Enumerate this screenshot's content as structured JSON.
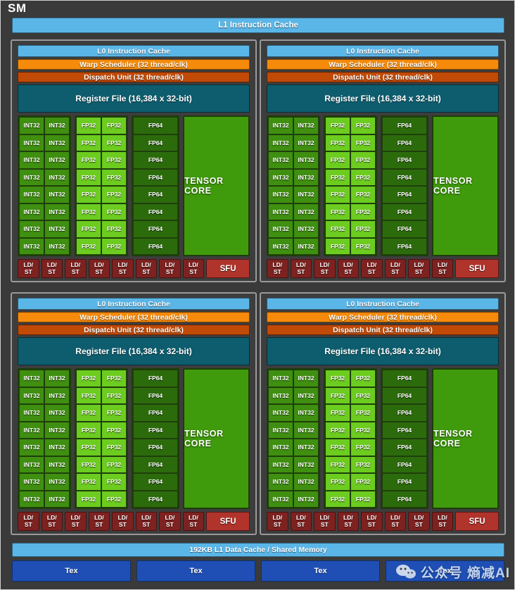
{
  "diagram": {
    "title": "SM",
    "top_cache": "L1 Instruction Cache",
    "bottom_cache": "192KB L1 Data Cache / Shared Memory"
  },
  "processing_block": {
    "l0_cache": "L0 Instruction Cache",
    "warp_scheduler": "Warp Scheduler (32 thread/clk)",
    "dispatch_unit": "Dispatch Unit (32 thread/clk)",
    "register_file": "Register File (16,384 x 32-bit)",
    "int32_label": "INT32",
    "fp32_label": "FP32",
    "fp64_label": "FP64",
    "tensor_core_label": "TENSOR CORE",
    "ldst_label_line1": "LD/",
    "ldst_label_line2": "ST",
    "sfu_label": "SFU",
    "int32_columns": 2,
    "fp32_columns": 2,
    "fp64_columns": 1,
    "rows": 8,
    "ldst_count": 8,
    "sfu_count": 1
  },
  "quadrants": [
    {
      "name": "processing-block-top-left"
    },
    {
      "name": "processing-block-top-right"
    },
    {
      "name": "processing-block-bottom-left"
    },
    {
      "name": "processing-block-bottom-right"
    }
  ],
  "tex_units": [
    "Tex",
    "Tex",
    "Tex",
    "Tex"
  ],
  "watermark": {
    "text": "公众号 熵减AI",
    "icon": "wechat-icon"
  },
  "colors": {
    "background": "#3a3a3a",
    "l1_cache": "#5bb6e8",
    "warp_scheduler": "#f58a0b",
    "dispatch_unit": "#c04a06",
    "register_file": "#0d5d6e",
    "int32": "#3f8f10",
    "fp32": "#6ccc1f",
    "fp64": "#2c6b0c",
    "tensor_core": "#409b0c",
    "ldst": "#7d2220",
    "sfu": "#b0342c",
    "tex": "#1f4fb5"
  }
}
